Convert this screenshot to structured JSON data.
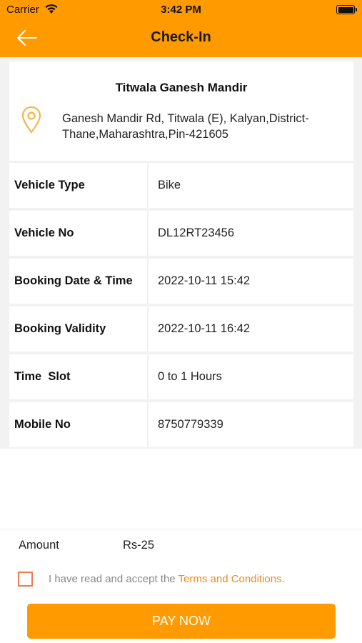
{
  "status_bar": {
    "carrier": "Carrier",
    "time": "3:42 PM"
  },
  "header": {
    "title": "Check-In",
    "back_icon": "arrow-left-icon",
    "bg_color": "#ff9a00"
  },
  "place": {
    "name": "Titwala Ganesh Mandir",
    "icon": "location-pin-icon",
    "address_line1": "Ganesh Mandir Rd, Titwala (E), Kalyan,District-",
    "address_line2": "Thane,Maharashtra,Pin-421605"
  },
  "details": [
    {
      "label": "Vehicle Type",
      "value": "Bike"
    },
    {
      "label": "Vehicle No",
      "value": "DL12RT23456"
    },
    {
      "label": "Booking Date & Time",
      "value": "2022-10-11 15:42"
    },
    {
      "label": "Booking Validity",
      "value": "2022-10-11 16:42"
    },
    {
      "label": "Time  Slot",
      "value": "0 to 1 Hours"
    },
    {
      "label": "Mobile No",
      "value": "8750779339"
    }
  ],
  "payment": {
    "amount_label": "Amount",
    "amount_value": "Rs-25",
    "terms_prefix": "I have read and accept the ",
    "terms_link": "Terms and Conditions.",
    "terms_checked": false,
    "pay_button": "PAY NOW",
    "accent_color": "#f08a1c"
  }
}
